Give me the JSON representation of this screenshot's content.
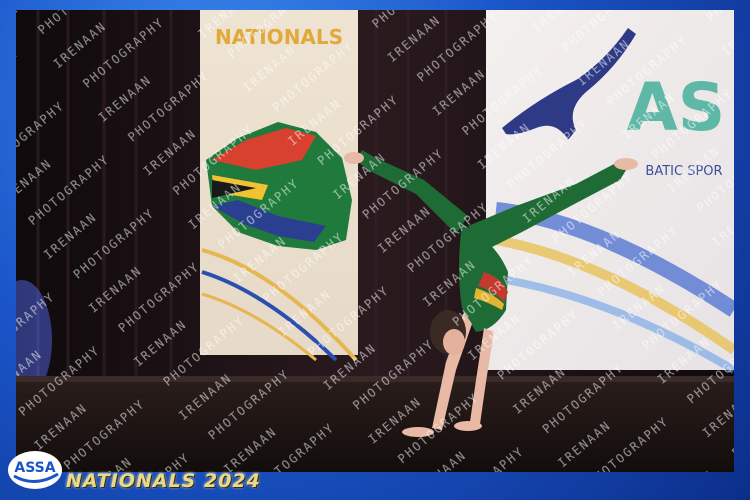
{
  "banner_left": {
    "text": "NATIONALS"
  },
  "banner_right": {
    "logo_text": "AS",
    "subtitle": "BATIC SPOR"
  },
  "footer": {
    "logo_text": "ASSA",
    "event": "NATIONALS 2024"
  },
  "watermark": {
    "text": "IRENAAN PHOTOGRAPHY"
  },
  "colors": {
    "frame": "#1a55c8",
    "gold": "#e9d98c",
    "leotard": "#1f6b35",
    "curtain": "#1b1013"
  }
}
